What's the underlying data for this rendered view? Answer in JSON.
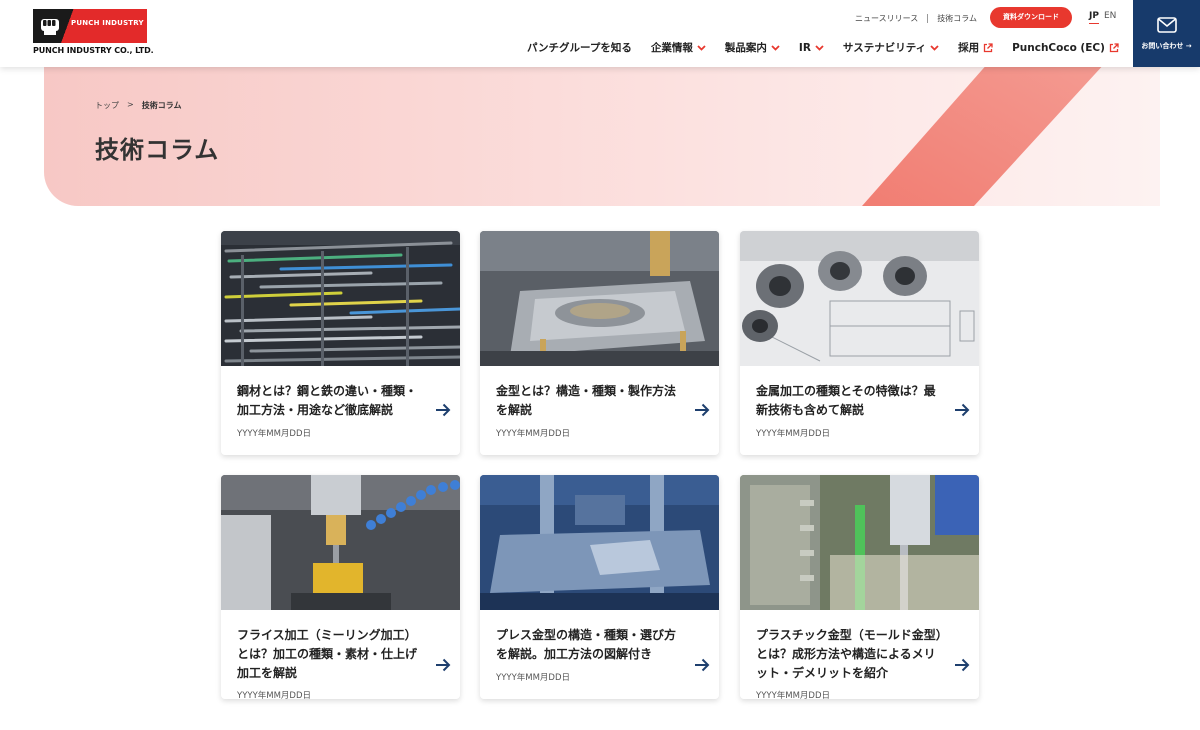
{
  "header": {
    "logo_mark_text": "PUNCH INDUSTRY",
    "logo_name": "PUNCH INDUSTRY CO., LTD.",
    "util_links": [
      "ニュースリリース",
      "技術コラム"
    ],
    "download_button": "資料ダウンロード",
    "lang_jp": "JP",
    "lang_en": "EN",
    "nav": [
      {
        "label": "パンチグループを知る",
        "icon": "none"
      },
      {
        "label": "企業情報",
        "icon": "chevron-down-icon"
      },
      {
        "label": "製品案内",
        "icon": "chevron-down-icon"
      },
      {
        "label": "IR",
        "icon": "chevron-down-icon"
      },
      {
        "label": "サステナビリティ",
        "icon": "chevron-down-icon"
      },
      {
        "label": "採用",
        "icon": "external-link-icon"
      },
      {
        "label": "PunchCoco (EC)",
        "icon": "external-link-icon"
      }
    ],
    "contact_label": "お問い合わせ →"
  },
  "hero": {
    "breadcrumb_home": "トップ",
    "breadcrumb_sep": ">",
    "breadcrumb_current": "技術コラム",
    "title": "技術コラム"
  },
  "cards": [
    {
      "title": "鋼材とは？鋼と鉄の違い・種類・加工方法・用途など徹底解説",
      "date": "YYYY年MM月DD日",
      "image": "steel-bars-photo"
    },
    {
      "title": "金型とは？構造・種類・製作方法を解説",
      "date": "YYYY年MM月DD日",
      "image": "mold-machining-photo"
    },
    {
      "title": "金属加工の種類とその特徴は？最新技術も含めて解説",
      "date": "YYYY年MM月DD日",
      "image": "metal-parts-blueprint-photo"
    },
    {
      "title": "フライス加工（ミーリング加工）とは？加工の種類・素材・仕上げ加工を解説",
      "date": "YYYY年MM月DD日",
      "image": "milling-machine-photo"
    },
    {
      "title": "プレス金型の構造・種類・選び方を解説。加工方法の図解付き",
      "date": "YYYY年MM月DD日",
      "image": "press-die-photo"
    },
    {
      "title": "プラスチック金型（モールド金型）とは？成形方法や構造によるメリット・デメリットを紹介",
      "date": "YYYY年MM月DD日",
      "image": "plastic-mold-photo"
    }
  ],
  "colors": {
    "brand_red": "#e8382e",
    "navy": "#173a6b",
    "arrow": "#1e3f6e"
  }
}
